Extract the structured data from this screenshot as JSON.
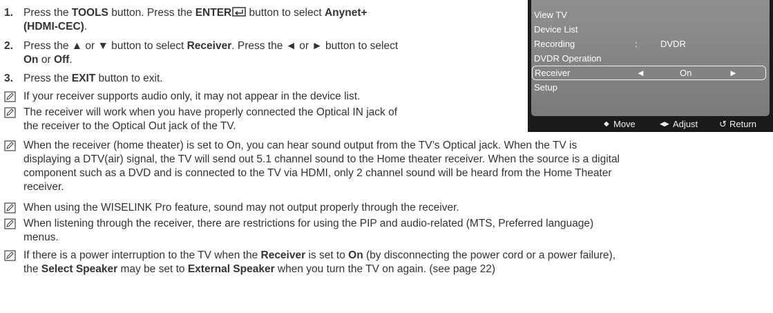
{
  "steps": [
    {
      "num": "1.",
      "line1": {
        "a": "Press the ",
        "b1": "TOOLS",
        "c": " button. Press the ",
        "b2": "ENTER",
        "d": " button to select ",
        "b3": "Anynet+"
      },
      "line2_bold": "(HDMI-CEC)",
      "line2_tail": "."
    },
    {
      "num": "2.",
      "line1": {
        "a": "Press the ▲ or ▼ button to select ",
        "b1": "Receiver",
        "c": ". Press the ◄ or ► button to select"
      },
      "line2": {
        "b1": "On",
        "a": " or ",
        "b2": "Off",
        "tail": "."
      }
    },
    {
      "num": "3.",
      "a": "Press the ",
      "b1": "EXIT",
      "c": " button to exit."
    }
  ],
  "notes": [
    {
      "text": "If your receiver supports audio only, it may not appear in the device list."
    },
    {
      "lines": [
        "The receiver will work when you have properly connected the Optical IN jack of",
        "the receiver to the Optical Out jack of the TV."
      ]
    },
    {
      "lines": [
        "When the receiver (home theater) is set to On, you can hear sound output from the TV’s Optical jack. When the TV is",
        "displaying a DTV(air) signal, the TV will send out 5.1 channel sound to the Home theater receiver. When the source is a digital",
        "component such as a DVD and is connected to the TV via HDMI, only 2 channel sound will be heard from the Home Theater",
        "receiver."
      ]
    },
    {
      "text": "When using the WISELINK Pro feature, sound may not output properly through the receiver."
    },
    {
      "lines": [
        "When listening through the receiver, there are restrictions for using the PIP and audio-related (MTS, Preferred language)",
        "menus."
      ]
    },
    {
      "l1": {
        "a": "If there is a power interruption to the TV when the ",
        "b1": "Receiver",
        "c": " is set to ",
        "b2": "On",
        "d": " (by disconnecting the power cord or a power failure),"
      },
      "l2": {
        "a": "the ",
        "b1": "Select Speaker",
        "c": " may be set to ",
        "b2": "External Speaker",
        "d": " when you turn the TV on again. (see page 22)"
      }
    }
  ],
  "osd": {
    "items": [
      {
        "label": "View TV"
      },
      {
        "label": "Device List"
      },
      {
        "label": "Recording",
        "sep": ":",
        "value": "DVDR"
      },
      {
        "label": "DVDR Operation"
      },
      {
        "label": "Receiver",
        "left": "◄",
        "value": "On",
        "right": "►"
      },
      {
        "label": "Setup"
      }
    ],
    "footer": {
      "move_icon": "◆",
      "move": "Move",
      "adjust_icon": "◀▶",
      "adjust": "Adjust",
      "return_icon": "↺",
      "return": "Return"
    }
  },
  "colors": {
    "text": "#333333",
    "osd_panel": "#888888",
    "osd_frame": "#1a1a1a"
  }
}
